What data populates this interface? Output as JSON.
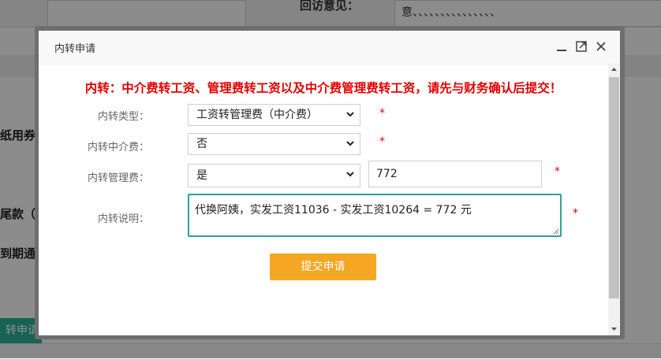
{
  "background": {
    "top_label": "回访意见：",
    "top_text": "意、、、、、、、、、、、、、、、",
    "side_labels": [
      "纸用券：",
      "尾款（元",
      "到期通知"
    ],
    "side_button": "转申请"
  },
  "dialog": {
    "title": "内转申请",
    "notice": "内转：中介费转工资、管理费转工资以及中介费管理费转工资，请先与财务确认后提交！",
    "fields": {
      "type": {
        "label": "内转类型：",
        "value": "工资转管理费（中介费）"
      },
      "agency_fee": {
        "label": "内转中介费：",
        "value": "否"
      },
      "mgmt_fee": {
        "label": "内转管理费：",
        "value": "是",
        "amount": "772"
      },
      "note": {
        "label": "内转说明：",
        "value": "代换阿姨，实发工资11036 - 实发工资10264 = 772 元"
      }
    },
    "required_mark": "*",
    "submit_label": "提交申请"
  },
  "colors": {
    "accent": "#2ba594",
    "notice": "#e60000",
    "submit": "#f5a623"
  }
}
